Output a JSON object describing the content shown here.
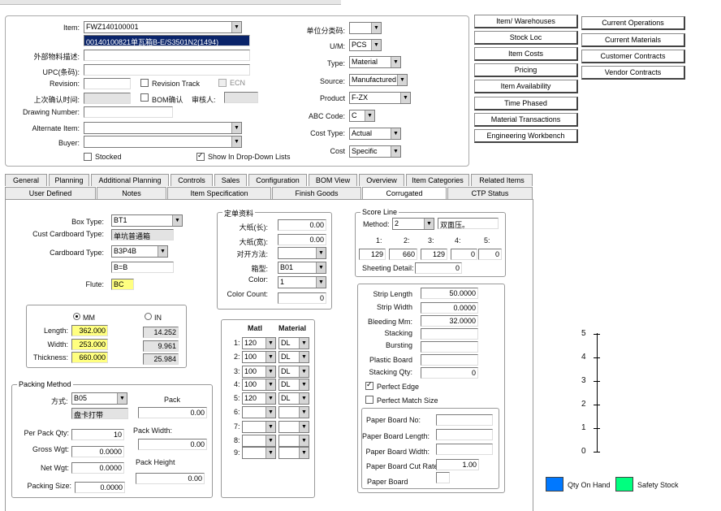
{
  "header": {
    "item_label": "Item:",
    "item_value": "FWZ140100001",
    "item_desc": "00140100821单瓦箱B-E/S3501N2(1494)",
    "ext_desc_label": "外部物料描述:",
    "upc_label": "UPC(条码):",
    "revision_label": "Revision:",
    "revision_track": "Revision Track",
    "ecn": "ECN",
    "last_confirm_label": "上次确认时间:",
    "bom_confirm": "BOM确认",
    "reviewer_label": "审核人:",
    "drawing_label": "Drawing Number:",
    "alt_item_label": "Alternate Item:",
    "buyer_label": "Buyer:",
    "stocked": "Stocked",
    "show_dropdown": "Show In Drop-Down Lists"
  },
  "props": {
    "unit_class_label": "单位分类码:",
    "unit_class_value": "",
    "um_label": "U/M:",
    "um_value": "PCS",
    "type_label": "Type:",
    "type_value": "Material",
    "source_label": "Source:",
    "source_value": "Manufactured",
    "product_label": "Product",
    "product_value": "F-ZX",
    "abc_label": "ABC Code:",
    "abc_value": "C",
    "cost_type_label": "Cost Type:",
    "cost_type_value": "Actual",
    "cost_label": "Cost",
    "cost_value": "Specific"
  },
  "buttons_left": [
    "Item/ Warehouses",
    "Stock Loc",
    "Item Costs",
    "Pricing",
    "Item Availability",
    "Time Phased",
    "Material Transactions",
    "Engineering Workbench"
  ],
  "buttons_right": [
    "Current Operations",
    "Current Materials",
    "Customer Contracts",
    "Vendor Contracts"
  ],
  "tabs_row1": [
    "General",
    "Planning",
    "Additional Planning",
    "Controls",
    "Sales",
    "Configuration",
    "BOM View",
    "Overview",
    "Item Categories",
    "Related Items"
  ],
  "tabs_row2": [
    "User Defined",
    "Notes",
    "Item Specification",
    "Finish Goods",
    "Corrugated",
    "CTP Status"
  ],
  "box": {
    "box_type_label": "Box Type:",
    "box_type": "BT1",
    "cust_label": "Cust Cardboard Type:",
    "cust_value": "单坑普通箱",
    "cb_type_label": "Cardboard Type:",
    "cb_type": "B3P4B",
    "cb_desc": "B=B",
    "flute_label": "Flute:",
    "flute": "BC"
  },
  "dims": {
    "mm": "MM",
    "in": "IN",
    "length_label": "Length:",
    "width_label": "Width:",
    "thickness_label": "Thickness:",
    "length_mm": "362.000",
    "width_mm": "253.000",
    "thickness_mm": "660.000",
    "length_in": "14.252",
    "width_in": "9.961",
    "thickness_in": "25.984"
  },
  "packing": {
    "title": "Packing Method",
    "method_label": "方式:",
    "method": "B05",
    "method_desc": "盘卡打带",
    "pack_label": "Pack",
    "pack": "0.00",
    "per_pack_label": "Per Pack Qty:",
    "per_pack": "10",
    "pack_width_label": "Pack Width:",
    "pack_width": "0.00",
    "gross_label": "Gross Wgt:",
    "gross": "0.0000",
    "net_label": "Net Wgt:",
    "net": "0.0000",
    "pack_height_label": "Pack Height",
    "pack_height": "0.00",
    "size_label": "Packing Size:",
    "size": "0.0000"
  },
  "sheet": {
    "title": "定单资料",
    "long_label": "大纸(长):",
    "long": "0.00",
    "wide_label": "大纸(宽):",
    "wide": "0.00",
    "open_label": "对开方法:",
    "open": "",
    "box_model_label": "箱型:",
    "box_model": "B01",
    "color_label": "Color:",
    "color": "1",
    "color_count_label": "Color Count:",
    "color_count": "0"
  },
  "materials": {
    "matl_header": "Matl",
    "material_header": "Material",
    "rows": [
      {
        "n": "1:",
        "matl": "120",
        "mat": "DL"
      },
      {
        "n": "2:",
        "matl": "100",
        "mat": "DL"
      },
      {
        "n": "3:",
        "matl": "100",
        "mat": "DL"
      },
      {
        "n": "4:",
        "matl": "100",
        "mat": "DL"
      },
      {
        "n": "5:",
        "matl": "120",
        "mat": "DL"
      },
      {
        "n": "6:",
        "matl": "",
        "mat": ""
      },
      {
        "n": "7:",
        "matl": "",
        "mat": ""
      },
      {
        "n": "8:",
        "matl": "",
        "mat": ""
      },
      {
        "n": "9:",
        "matl": "",
        "mat": ""
      }
    ]
  },
  "score": {
    "title": "Score Line",
    "method_label": "Method:",
    "method": "2",
    "method_desc": "双面压。",
    "labels": [
      "1:",
      "2:",
      "3:",
      "4:",
      "5:"
    ],
    "values": [
      "129",
      "660",
      "129",
      "0",
      "0"
    ],
    "sheeting_label": "Sheeting Detail:",
    "sheeting": "0"
  },
  "strip": {
    "strip_length_label": "Strip Length",
    "strip_length": "50.0000",
    "strip_width_label": "Strip Width",
    "strip_width": "0.0000",
    "bleeding_label": "Bleeding Mm:",
    "bleeding": "32.0000",
    "stacking_label": "Stacking",
    "stacking": "",
    "bursting_label": "Bursting",
    "bursting": "",
    "plastic_label": "Plastic Board",
    "plastic": "",
    "stack_qty_label": "Stacking Qty:",
    "stack_qty": "0",
    "perfect_edge": "Perfect Edge",
    "perfect_match": "Perfect Match Size"
  },
  "paper": {
    "no_label": "Paper Board No:",
    "length_label": "Paper Board Length:",
    "width_label": "Paper Board Width:",
    "cut_label": "Paper Board Cut Rate:",
    "cut": "1.00",
    "board_label": "Paper Board"
  },
  "chart_data": {
    "type": "bar",
    "y_ticks": [
      "5",
      "4",
      "3",
      "2",
      "1",
      "0"
    ],
    "series": [
      {
        "name": "Qty On Hand",
        "color": "#0078ff"
      },
      {
        "name": "Safety Stock",
        "color": "#00ff7f"
      }
    ]
  }
}
